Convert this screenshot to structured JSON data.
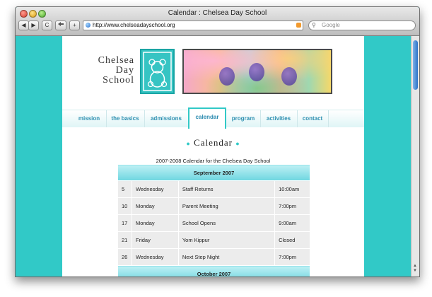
{
  "browser": {
    "title": "Calendar : Chelsea Day School",
    "url": "http://www.chelseadayschool.org",
    "search_placeholder": "Google",
    "back_label": "◀",
    "forward_label": "▶",
    "reload_label": "C",
    "add_label": "+"
  },
  "site": {
    "school_name": [
      "Chelsea",
      "Day",
      "School"
    ],
    "nav": [
      {
        "label": "mission"
      },
      {
        "label": "the basics"
      },
      {
        "label": "admissions"
      },
      {
        "label": "calendar",
        "active": true
      },
      {
        "label": "program"
      },
      {
        "label": "activities"
      },
      {
        "label": "contact"
      }
    ],
    "page_title": "Calendar",
    "caption": "2007-2008 Calendar for the Chelsea Day School"
  },
  "calendar": {
    "months": [
      {
        "name": "September 2007",
        "events": [
          {
            "day": "5",
            "weekday": "Wednesday",
            "event": "Staff Returns",
            "time": "10:00am"
          },
          {
            "day": "10",
            "weekday": "Monday",
            "event": "Parent Meeting",
            "time": "7:00pm"
          },
          {
            "day": "17",
            "weekday": "Monday",
            "event": "School Opens",
            "time": "9:00am"
          },
          {
            "day": "21",
            "weekday": "Friday",
            "event": "Yom Kippur",
            "time": "Closed"
          },
          {
            "day": "26",
            "weekday": "Wednesday",
            "event": "Next Step Night",
            "time": "7:00pm"
          }
        ]
      },
      {
        "name": "October 2007",
        "events": []
      }
    ]
  },
  "colors": {
    "background_teal": "#31c9c7",
    "nav_text": "#2d8fb0",
    "month_header": "#6ed6e0"
  }
}
